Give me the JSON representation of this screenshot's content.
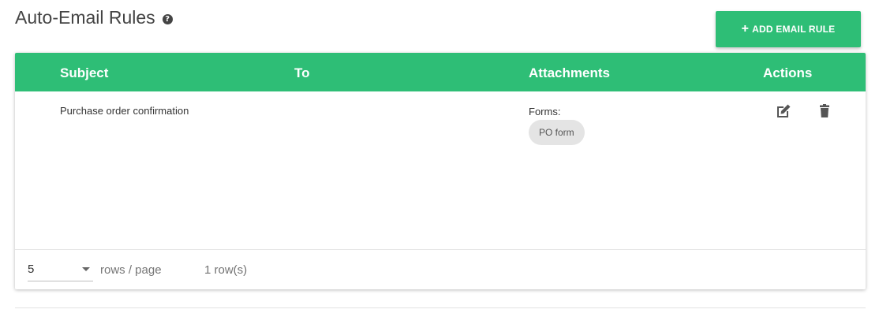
{
  "header": {
    "title": "Auto-Email Rules",
    "help_icon": "question-circle-icon",
    "help_glyph": "?",
    "add_button": {
      "icon": "plus-icon",
      "icon_glyph": "+",
      "label": "ADD EMAIL RULE"
    }
  },
  "table": {
    "columns": [
      "Subject",
      "To",
      "Attachments",
      "Actions"
    ],
    "rows": [
      {
        "subject": "Purchase order confirmation",
        "to": "",
        "attachments": {
          "label": "Forms:",
          "chips": [
            "PO form"
          ]
        },
        "actions": [
          "edit-icon",
          "delete-icon"
        ]
      }
    ]
  },
  "footer": {
    "rows_per_page_value": "5",
    "rows_per_page_label": "rows / page",
    "row_count": "1 row(s)"
  },
  "colors": {
    "accent": "#2ebe76",
    "header_text": "#ffffff",
    "chip_bg": "#e4e4e4"
  }
}
